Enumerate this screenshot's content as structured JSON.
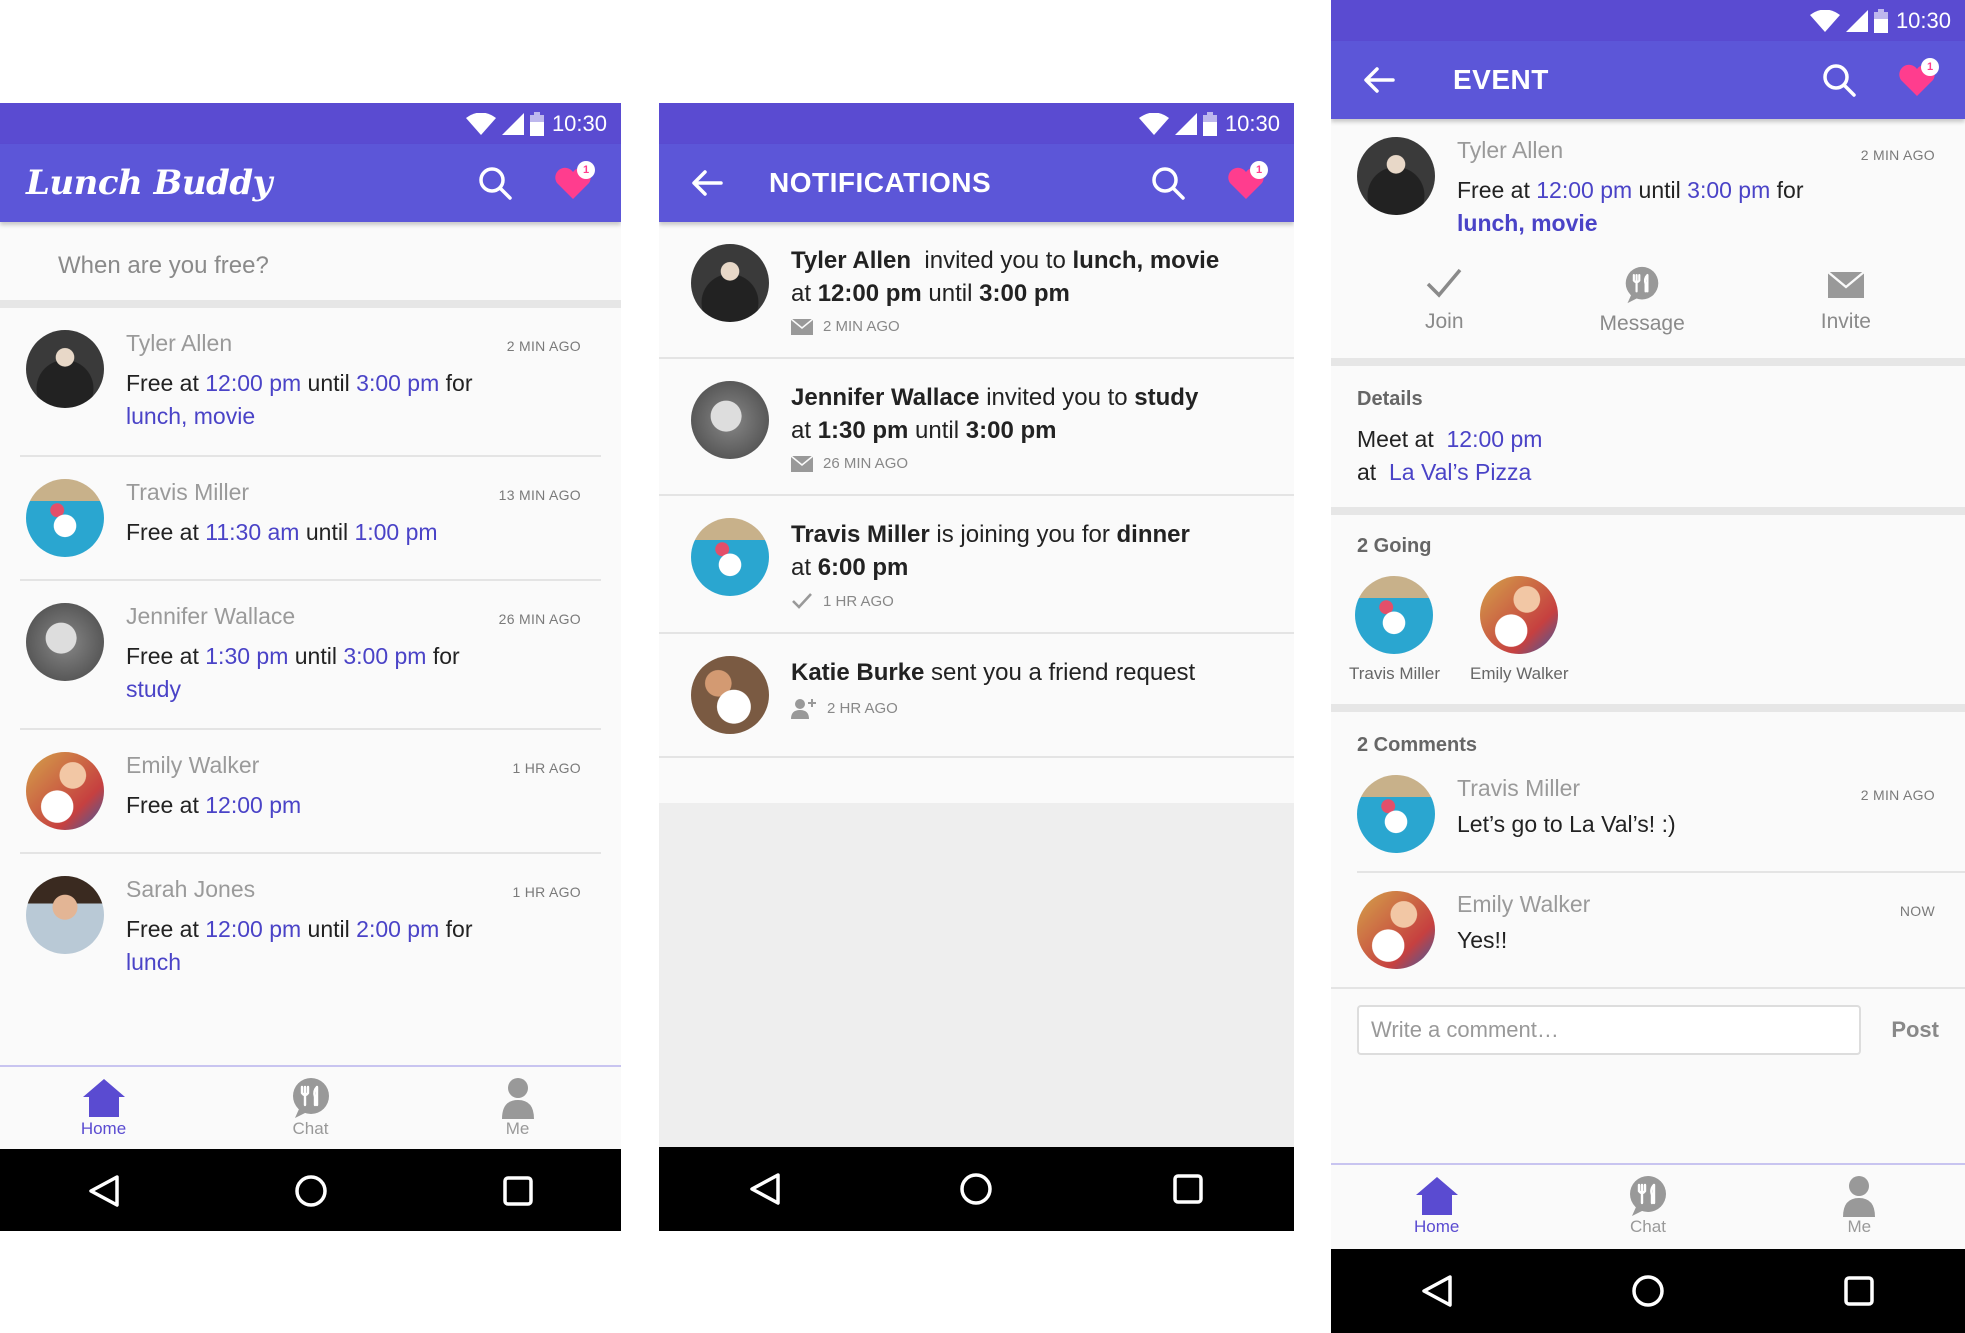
{
  "status": {
    "time": "10:30"
  },
  "home": {
    "logo": "Lunch Buddy",
    "badge_count": "1",
    "search_placeholder": "When are you free?",
    "feed": [
      {
        "name": "Tyler Allen",
        "time": "2 MIN AGO",
        "prefix": "Free at ",
        "start": "12:00 pm",
        "mid": " until ",
        "end": "3:00 pm",
        "for": " for",
        "activity": "lunch, movie"
      },
      {
        "name": "Travis Miller",
        "time": "13 MIN AGO",
        "prefix": "Free at ",
        "start": "11:30 am",
        "mid": " until ",
        "end": "1:00 pm",
        "for": "",
        "activity": ""
      },
      {
        "name": "Jennifer Wallace",
        "time": "26 MIN AGO",
        "prefix": "Free at ",
        "start": "1:30 pm",
        "mid": " until ",
        "end": "3:00 pm",
        "for": " for",
        "activity": "study"
      },
      {
        "name": "Emily Walker",
        "time": "1 HR AGO",
        "prefix": "Free at ",
        "start": "12:00 pm",
        "mid": "",
        "end": "",
        "for": "",
        "activity": ""
      },
      {
        "name": "Sarah Jones",
        "time": "1 HR AGO",
        "prefix": "Free at ",
        "start": "12:00 pm",
        "mid": " until ",
        "end": "2:00 pm",
        "for": " for",
        "activity": "lunch"
      }
    ]
  },
  "nav": {
    "home": "Home",
    "chat": "Chat",
    "me": "Me"
  },
  "notifications": {
    "title": "NOTIFICATIONS",
    "items": [
      {
        "name": "Tyler Allen",
        "verb": "  invited you to ",
        "what": "lunch, movie",
        "line2_pre": "at ",
        "t1": "12:00 pm",
        "mid": " until ",
        "t2": "3:00 pm",
        "time": "2 MIN AGO",
        "icon": "mail-icon"
      },
      {
        "name": "Jennifer Wallace",
        "verb": " invited you to ",
        "what": "study",
        "line2_pre": "at ",
        "t1": "1:30 pm",
        "mid": " until ",
        "t2": "3:00 pm",
        "time": "26 MIN AGO",
        "icon": "mail-icon"
      },
      {
        "name": "Travis Miller",
        "verb": " is joining you for ",
        "what": "dinner",
        "line2_pre": "at ",
        "t1": "6:00 pm",
        "mid": "",
        "t2": "",
        "time": "1 HR AGO",
        "icon": "check-icon"
      },
      {
        "name": "Katie Burke",
        "verb": " sent you a friend request",
        "what": "",
        "line2_pre": "",
        "t1": "",
        "mid": "",
        "t2": "",
        "time": "2 HR AGO",
        "icon": "add-person-icon"
      }
    ]
  },
  "event": {
    "title": "EVENT",
    "host": {
      "name": "Tyler Allen",
      "time": "2 MIN AGO",
      "prefix": "Free at ",
      "start": "12:00 pm",
      "mid": " until ",
      "end": "3:00 pm",
      "for": " for",
      "activity": "lunch, movie"
    },
    "actions": {
      "join": "Join",
      "message": "Message",
      "invite": "Invite"
    },
    "details": {
      "title": "Details",
      "meet_label": "Meet at ",
      "meet_time": "12:00 pm",
      "at_label": "at ",
      "place": "La Val’s Pizza"
    },
    "going": {
      "title": "2 Going",
      "people": [
        "Travis Miller",
        "Emily Walker"
      ]
    },
    "comments": {
      "title": "2 Comments",
      "items": [
        {
          "name": "Travis Miller",
          "time": "2 MIN AGO",
          "text": "Let’s go to La Val’s! :)"
        },
        {
          "name": "Emily Walker",
          "time": "NOW",
          "text": "Yes!!"
        }
      ],
      "placeholder": "Write a comment…",
      "post": "Post"
    }
  },
  "colors": {
    "primary": "#5c56d8",
    "status": "#5a4bd1",
    "accent_text": "#4a43c7",
    "heart": "#ff3d8e"
  }
}
